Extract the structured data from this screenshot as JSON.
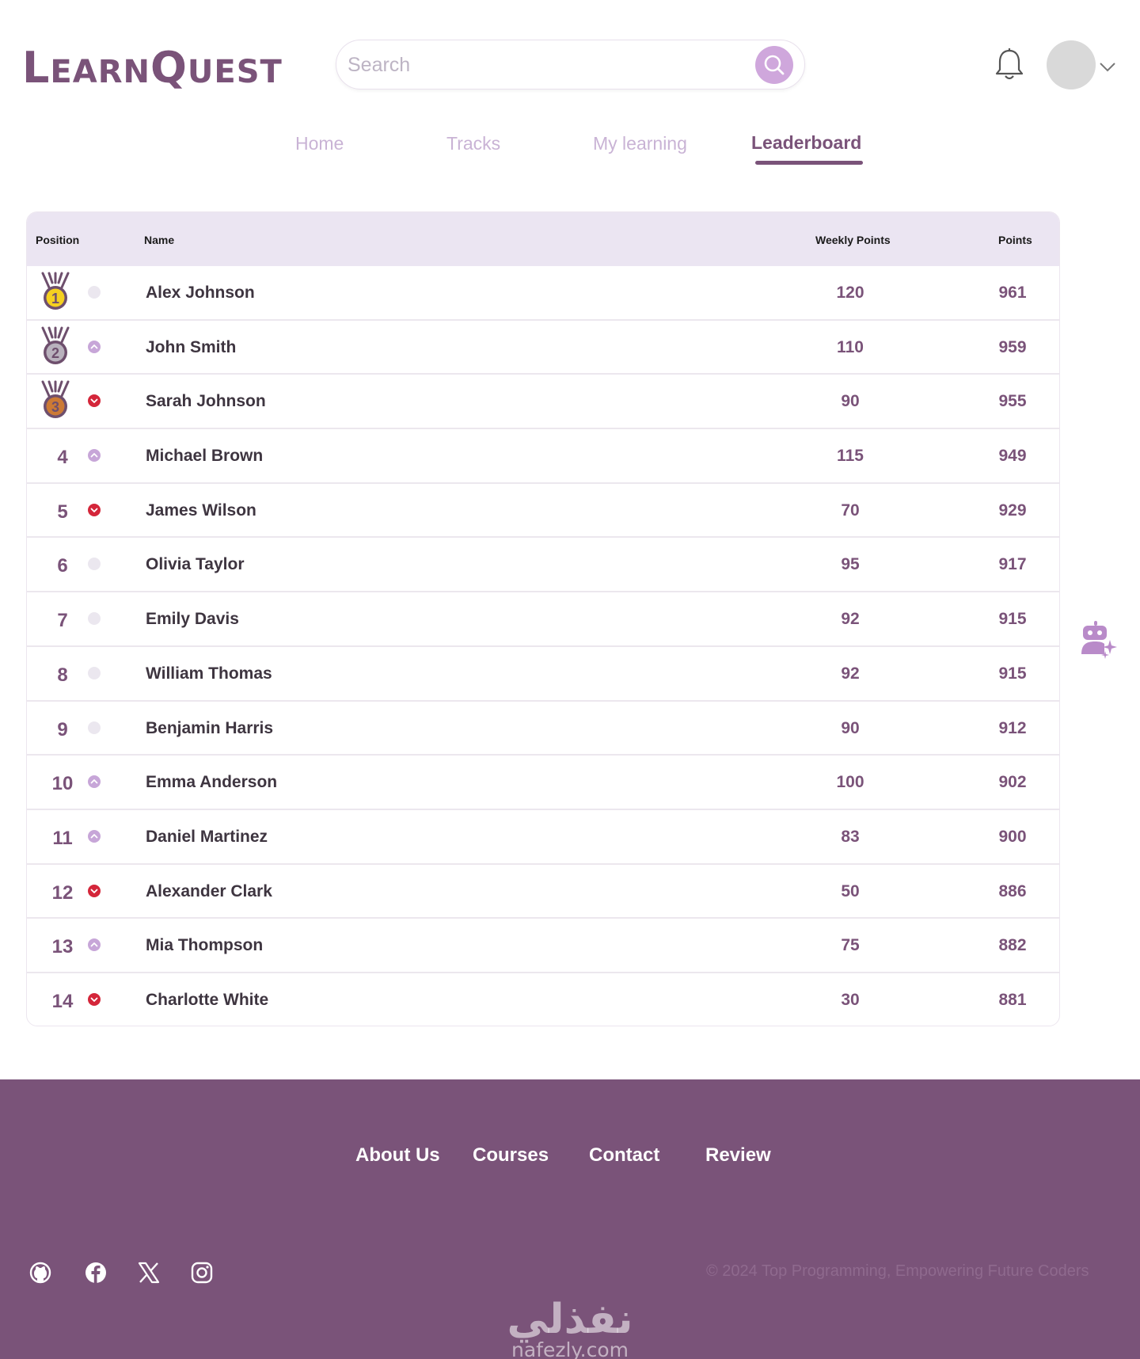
{
  "brand": {
    "logo_text": "LearnQuest",
    "accent": "#7a5379",
    "light_accent": "#cfa7dc"
  },
  "search": {
    "placeholder": "Search"
  },
  "header_icons": [
    "bell-icon",
    "avatar",
    "chevron-down-icon"
  ],
  "nav": {
    "home": "Home",
    "tracks": "Tracks",
    "my_learning": "My learning",
    "leaderboard": "Leaderboard",
    "active": "Leaderboard"
  },
  "table": {
    "headers": {
      "position": "Position",
      "name": "Name",
      "weekly": "Weekly Points",
      "points": "Points"
    },
    "rows": [
      {
        "pos": "1",
        "medal": "gold",
        "trend": "neutral",
        "name": "Alex Johnson",
        "weekly": "120",
        "points": "961"
      },
      {
        "pos": "2",
        "medal": "silver",
        "trend": "up",
        "name": "John Smith",
        "weekly": "110",
        "points": "959"
      },
      {
        "pos": "3",
        "medal": "bronze",
        "trend": "down",
        "name": "Sarah Johnson",
        "weekly": "90",
        "points": "955"
      },
      {
        "pos": "4",
        "trend": "up",
        "name": "Michael Brown",
        "weekly": "115",
        "points": "949"
      },
      {
        "pos": "5",
        "trend": "down",
        "name": "James Wilson",
        "weekly": "70",
        "points": "929"
      },
      {
        "pos": "6",
        "trend": "neutral",
        "name": "Olivia Taylor",
        "weekly": "95",
        "points": "917"
      },
      {
        "pos": "7",
        "trend": "neutral",
        "name": "Emily Davis",
        "weekly": "92",
        "points": "915"
      },
      {
        "pos": "8",
        "trend": "neutral",
        "name": "William Thomas",
        "weekly": "92",
        "points": "915"
      },
      {
        "pos": "9",
        "trend": "neutral",
        "name": "Benjamin Harris",
        "weekly": "90",
        "points": "912"
      },
      {
        "pos": "10",
        "trend": "up",
        "name": "Emma Anderson",
        "weekly": "100",
        "points": "902"
      },
      {
        "pos": "11",
        "trend": "up",
        "name": "Daniel Martinez",
        "weekly": "83",
        "points": "900"
      },
      {
        "pos": "12",
        "trend": "down",
        "name": "Alexander Clark",
        "weekly": "50",
        "points": "886"
      },
      {
        "pos": "13",
        "trend": "up",
        "name": "Mia Thompson",
        "weekly": "75",
        "points": "882"
      },
      {
        "pos": "14",
        "trend": "down",
        "name": "Charlotte White",
        "weekly": "30",
        "points": "881"
      }
    ],
    "trend_colors": {
      "up": "#c7a6d8",
      "down": "#d4263a",
      "neutral": "#ebe7ef"
    },
    "medal_colors": {
      "gold": "#f5d020",
      "silver": "#b9b2bd",
      "bronze": "#cc7a35"
    }
  },
  "assistant": {
    "icon": "ai-assistant-icon"
  },
  "footer": {
    "links": {
      "about": "About Us",
      "courses": "Courses",
      "contact": "Contact",
      "review": "Review"
    },
    "social": [
      "github-icon",
      "facebook-icon",
      "x-icon",
      "instagram-icon"
    ],
    "copyright": "© 2024 Top Programming, Empowering Future Coders",
    "watermark_arabic": "نفذلي",
    "watermark_latin": "nafezly.com"
  }
}
